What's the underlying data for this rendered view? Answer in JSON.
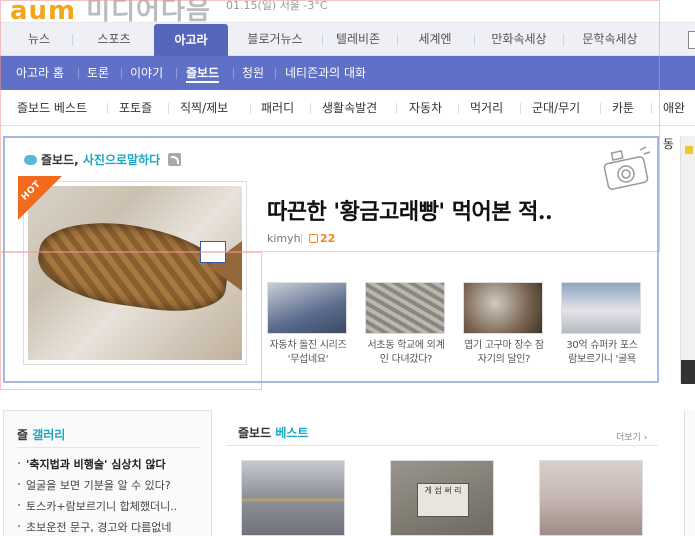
{
  "header": {
    "logo_text": "aum 미디어다음",
    "weather": "01.15(일) 서울 -3°C"
  },
  "main_tabs": [
    {
      "label": "뉴스"
    },
    {
      "label": "스포츠"
    },
    {
      "label": "아고라"
    },
    {
      "label": "블로거뉴스"
    },
    {
      "label": "텔레비존"
    },
    {
      "label": "세계엔"
    },
    {
      "label": "만화속세상"
    },
    {
      "label": "문학속세상"
    }
  ],
  "active_main_tab": "아고라",
  "subnav": [
    {
      "label": "아고라 홈"
    },
    {
      "label": "토론"
    },
    {
      "label": "이야기"
    },
    {
      "label": "즐보드"
    },
    {
      "label": "청원"
    },
    {
      "label": "네티즌과의 대화"
    }
  ],
  "active_subnav": "즐보드",
  "categories": [
    {
      "label": "즐보드 베스트"
    },
    {
      "label": "포토즐"
    },
    {
      "label": "직찍/제보"
    },
    {
      "label": "패러디"
    },
    {
      "label": "생활속발견"
    },
    {
      "label": "자동차"
    },
    {
      "label": "먹거리"
    },
    {
      "label": "군대/무기"
    },
    {
      "label": "카툰"
    },
    {
      "label": "애완동"
    }
  ],
  "feature": {
    "section_prefix": "즐보드, ",
    "section_accent": "사진으로말하다",
    "hot_badge": "HOT",
    "headline": "따끈한 '황금고래빵' 먹어본 적..",
    "author": "kimyh",
    "likes": "22",
    "thumbnails": [
      {
        "caption": "자동차 돌진 시리즈 '무섭네요'",
        "color": "#5a6b8c"
      },
      {
        "caption": "서초동 학교에 외계인 다녀갔다?",
        "color": "#8a8680"
      },
      {
        "caption": "엽기 고구마 장수 잠자기의 달인?",
        "color": "#7a6552"
      },
      {
        "caption": "30억 슈퍼카 포스 람보르기니 '굴욕",
        "color": "#b7b9c2"
      }
    ]
  },
  "gallery": {
    "title_prefix": "즐 ",
    "title_accent": "갤러리",
    "items": [
      {
        "text": "'축지법과 비행술' 심상치 않다",
        "bold": true
      },
      {
        "text": "얼굴을 보면 기분을 알 수 있다?",
        "bold": false
      },
      {
        "text": "토스카+람보르기니 합체했더니..",
        "bold": false
      },
      {
        "text": "초보운전 문구, 경고와 다름없네",
        "bold": false
      }
    ]
  },
  "best": {
    "title_prefix": "즐보드 ",
    "title_accent": "베스트",
    "more_label": "더보기 ›",
    "images": [
      {
        "color": "#8c8f98",
        "label": ""
      },
      {
        "color": "#6e6a60",
        "label": "게 섬 써 리"
      },
      {
        "color": "#c7b7b2",
        "label": ""
      }
    ]
  },
  "colors": {
    "tab_active": "#5566bb",
    "subnav_bg": "#6070c6",
    "accent": "#1aa7c0",
    "hot": "#f26b1d",
    "feature_border": "#a9b6e2"
  }
}
